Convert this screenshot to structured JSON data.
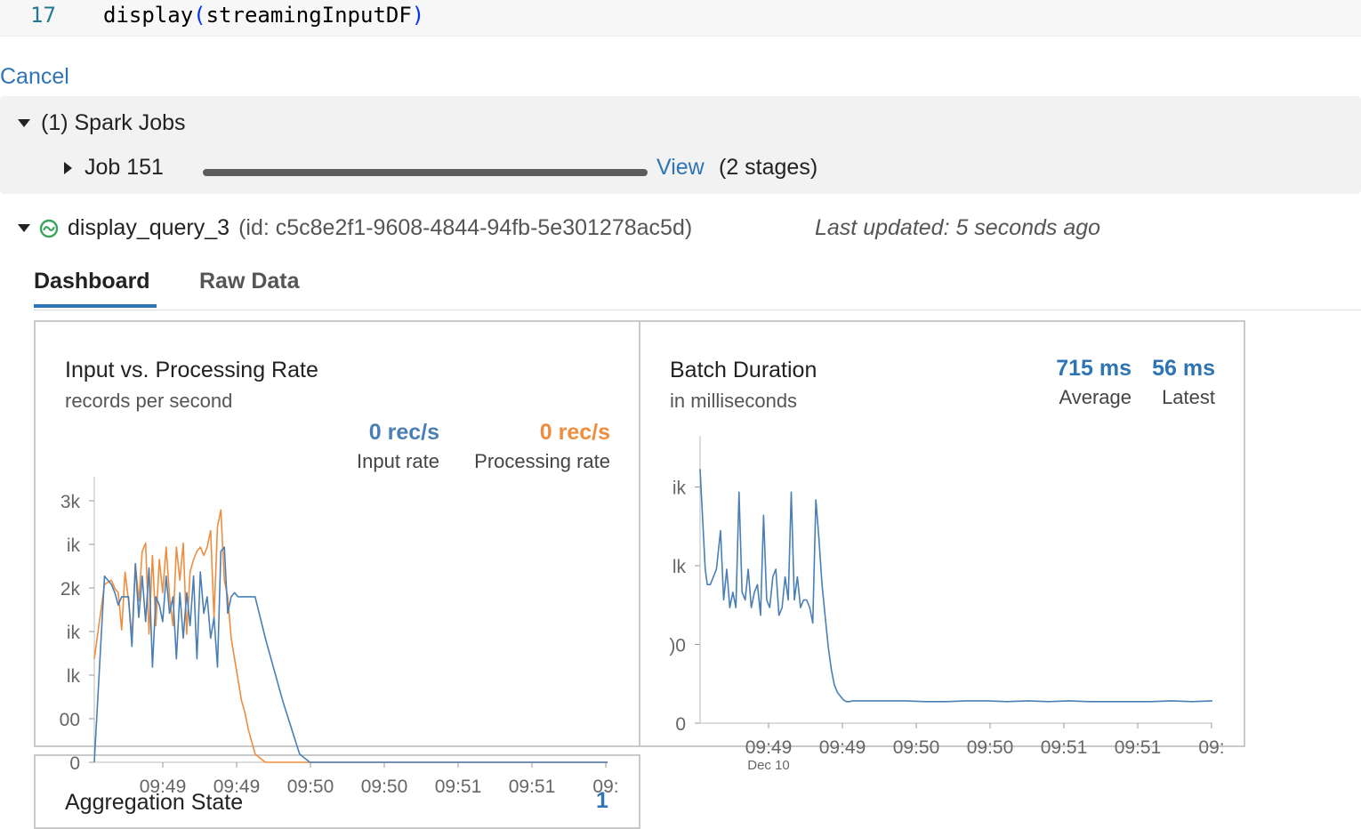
{
  "code": {
    "line_number": "17",
    "func": "display",
    "open_paren": "(",
    "arg": "streamingInputDF",
    "close_paren": ")"
  },
  "cancel_label": "Cancel",
  "spark_jobs": {
    "header": "(1) Spark Jobs",
    "job_label": "Job 151",
    "progress": 1.0,
    "view_label": "View",
    "stages_label": "(2 stages)"
  },
  "query": {
    "name": "display_query_3",
    "id_text": "(id: c5c8e2f1-9608-4844-94fb-5e301278ac5d)",
    "last_updated": "Last updated: 5 seconds ago",
    "status_color": "#3aa55d"
  },
  "tabs": {
    "dashboard": "Dashboard",
    "raw_data": "Raw Data"
  },
  "colors": {
    "input_series": "#4a7fb5",
    "processing_series": "#ef8d3f",
    "accent": "#2f74b5"
  },
  "panels": {
    "rate": {
      "title": "Input vs. Processing Rate",
      "subtitle": "records per second",
      "input_value": "0 rec/s",
      "input_label": "Input rate",
      "processing_value": "0 rec/s",
      "processing_label": "Processing rate"
    },
    "batch": {
      "title": "Batch Duration",
      "subtitle": "in milliseconds",
      "avg_value": "715 ms",
      "avg_label": "Average",
      "latest_value": "56 ms",
      "latest_label": "Latest"
    },
    "aggregation": {
      "title": "Aggregation State",
      "value_partial": "1"
    }
  },
  "chart_data": [
    {
      "type": "line",
      "title": "Input vs. Processing Rate",
      "y_tick_labels": [
        "0",
        "00",
        "lk",
        "ik",
        "2k",
        "ik",
        "3k"
      ],
      "x_tick_labels": [
        "09:49",
        "09:49",
        "09:50",
        "09:50",
        "09:51",
        "09:51",
        "09:"
      ],
      "ylim": [
        0,
        6.6
      ],
      "series": [
        {
          "name": "Input rate",
          "color": "#4a7fb5",
          "x": [
            0,
            0.6,
            1.0,
            1.2,
            1.4,
            1.6,
            1.8,
            2.0,
            2.2,
            2.4,
            2.6,
            2.8,
            3.0,
            3.2,
            3.4,
            3.6,
            3.8,
            4.0,
            4.2,
            4.4,
            4.6,
            4.8,
            5.0,
            5.2,
            5.4,
            5.6,
            5.8,
            6.0,
            6.2,
            6.4,
            6.6,
            6.8,
            7.0,
            7.2,
            7.4,
            7.6,
            7.8,
            8.0,
            8.2,
            8.4,
            8.6,
            8.8,
            9.0,
            9.2,
            9.4,
            10.0,
            11.0,
            12.0,
            12.6,
            14,
            16,
            18,
            20,
            22,
            24,
            26,
            28,
            30
          ],
          "y": [
            0,
            4.5,
            4.3,
            4.1,
            3.8,
            4.0,
            4.0,
            4.0,
            2.8,
            4.8,
            3.5,
            4.5,
            3.4,
            4.7,
            2.3,
            4.0,
            3.8,
            3.4,
            4.5,
            3.6,
            4.0,
            2.5,
            4.1,
            3.0,
            4.1,
            3.3,
            4.5,
            2.5,
            4.6,
            3.6,
            4.0,
            3.0,
            3.5,
            2.3,
            5.1,
            5.2,
            3.6,
            4.0,
            4.1,
            4.0,
            4.0,
            4.0,
            4.0,
            4.0,
            4.0,
            3.0,
            1.5,
            0.2,
            0,
            0,
            0,
            0,
            0,
            0,
            0,
            0,
            0,
            0
          ]
        },
        {
          "name": "Processing rate",
          "color": "#ef8d3f",
          "x": [
            0,
            0.6,
            1.0,
            1.2,
            1.4,
            1.6,
            1.8,
            2.0,
            2.2,
            2.4,
            2.6,
            2.8,
            3.0,
            3.2,
            3.4,
            3.6,
            3.8,
            4.0,
            4.2,
            4.4,
            4.6,
            4.8,
            5.0,
            5.2,
            5.4,
            5.6,
            5.8,
            6.0,
            6.2,
            6.4,
            6.6,
            6.8,
            7.0,
            7.2,
            7.4,
            7.6,
            7.8,
            8.0,
            8.2,
            8.4,
            8.6,
            8.8,
            9.0,
            9.2,
            9.4,
            10.0,
            11.0,
            12.0,
            12.6,
            14,
            16,
            18,
            20,
            22,
            24,
            26,
            28,
            30
          ],
          "y": [
            2.5,
            4.3,
            4.4,
            4.2,
            4.1,
            3.2,
            4.6,
            3.9,
            3.0,
            4.8,
            3.9,
            5.1,
            5.3,
            3.1,
            5.0,
            3.3,
            4.9,
            4.1,
            5.2,
            4.0,
            3.3,
            5.2,
            4.4,
            5.3,
            3.1,
            4.6,
            4.9,
            5.1,
            5.2,
            5.0,
            5.2,
            5.6,
            3.5,
            5.7,
            6.1,
            4.4,
            4.0,
            3.0,
            2.5,
            2.0,
            1.5,
            1.2,
            0.8,
            0.5,
            0.2,
            0,
            0,
            0,
            0,
            0,
            0,
            0,
            0,
            0,
            0,
            0,
            0,
            0
          ]
        }
      ]
    },
    {
      "type": "line",
      "title": "Batch Duration",
      "y_tick_labels": [
        "0",
        ")0",
        "lk",
        "ik"
      ],
      "x_tick_labels": [
        "09:49",
        "09:49",
        "09:50",
        "09:50",
        "09:51",
        "09:51",
        "09:"
      ],
      "x_sublabel": "Dec 10",
      "ylim": [
        0,
        3.5
      ],
      "series": [
        {
          "name": "Batch duration",
          "color": "#4a7fb5",
          "x": [
            0,
            0.5,
            0.7,
            1.0,
            1.3,
            1.6,
            2.0,
            2.3,
            2.6,
            2.9,
            3.2,
            3.5,
            3.8,
            4.1,
            4.4,
            4.7,
            5.0,
            5.3,
            5.6,
            5.9,
            6.2,
            6.5,
            6.8,
            7.1,
            7.4,
            7.7,
            8.0,
            8.3,
            8.6,
            8.9,
            9.2,
            9.5,
            9.8,
            10.1,
            10.4,
            10.7,
            11.0,
            11.3,
            11.6,
            11.9,
            12.2,
            12.5,
            12.8,
            13.1,
            13.4,
            13.7,
            14.0,
            14.3,
            14.6,
            14.9,
            15.2,
            15.5,
            16.5,
            18,
            20,
            22,
            24,
            26,
            28,
            30,
            32,
            34,
            36,
            38,
            40,
            42,
            44,
            46,
            48,
            50
          ],
          "y": [
            3.3,
            2.0,
            1.8,
            1.8,
            1.9,
            2.0,
            2.5,
            1.6,
            2.0,
            1.5,
            1.7,
            1.5,
            3.0,
            1.7,
            1.6,
            2.0,
            1.5,
            1.7,
            1.8,
            1.4,
            2.7,
            1.6,
            1.5,
            1.9,
            2.0,
            1.4,
            1.5,
            1.9,
            1.6,
            3.0,
            1.6,
            1.9,
            1.5,
            1.6,
            1.6,
            1.5,
            1.3,
            2.9,
            2.4,
            1.8,
            1.4,
            1.0,
            0.7,
            0.5,
            0.4,
            0.35,
            0.3,
            0.28,
            0.28,
            0.29,
            0.29,
            0.29,
            0.29,
            0.29,
            0.29,
            0.28,
            0.28,
            0.29,
            0.29,
            0.28,
            0.29,
            0.28,
            0.29,
            0.28,
            0.28,
            0.28,
            0.28,
            0.29,
            0.28,
            0.29
          ]
        }
      ]
    }
  ]
}
